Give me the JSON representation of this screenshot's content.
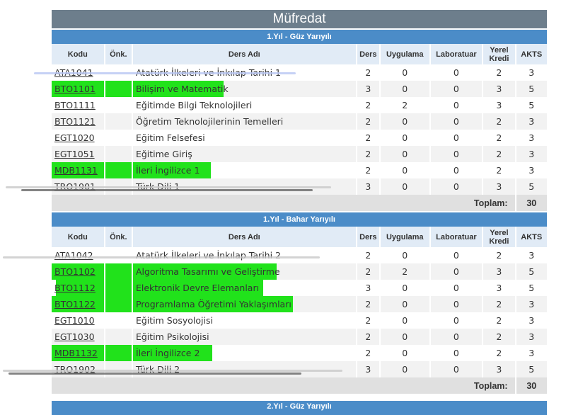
{
  "page_title": "Müfredat",
  "columns": [
    "Kodu",
    "Önk.",
    "Ders Adı",
    "Ders",
    "Uygulama",
    "Laboratuar",
    "Yerel Kredi",
    "AKTS"
  ],
  "total_label": "Toplam:",
  "semesters": [
    {
      "title": "1.Yıl - Güz Yarıyılı",
      "total": "30",
      "courses": [
        {
          "code": "ATA1041",
          "name": "Atatürk İlkeleri ve İnkılap Tarihi 1",
          "ders": "2",
          "uyg": "0",
          "lab": "0",
          "kredi": "2",
          "akts": "3"
        },
        {
          "code": "BTO1101",
          "name": "Bilişim ve Matematik",
          "ders": "3",
          "uyg": "0",
          "lab": "0",
          "kredi": "3",
          "akts": "5"
        },
        {
          "code": "BTO1111",
          "name": "Eğitimde Bilgi Teknolojileri",
          "ders": "2",
          "uyg": "2",
          "lab": "0",
          "kredi": "3",
          "akts": "5"
        },
        {
          "code": "BTO1121",
          "name": "Öğretim Teknolojilerinin Temelleri",
          "ders": "2",
          "uyg": "0",
          "lab": "0",
          "kredi": "2",
          "akts": "3"
        },
        {
          "code": "EGT1020",
          "name": "Eğitim Felsefesi",
          "ders": "2",
          "uyg": "0",
          "lab": "0",
          "kredi": "2",
          "akts": "3"
        },
        {
          "code": "EGT1051",
          "name": "Eğitime Giriş",
          "ders": "2",
          "uyg": "0",
          "lab": "0",
          "kredi": "2",
          "akts": "3"
        },
        {
          "code": "MDB1131",
          "name": "İleri İngilizce 1",
          "ders": "2",
          "uyg": "0",
          "lab": "0",
          "kredi": "2",
          "akts": "3"
        },
        {
          "code": "TRO1901",
          "name": "Türk Dili 1",
          "ders": "3",
          "uyg": "0",
          "lab": "0",
          "kredi": "3",
          "akts": "5"
        }
      ]
    },
    {
      "title": "1.Yıl - Bahar Yarıyılı",
      "total": "30",
      "courses": [
        {
          "code": "ATA1042",
          "name": "Atatürk İlkeleri ve İnkılap Tarihi 2",
          "ders": "2",
          "uyg": "0",
          "lab": "0",
          "kredi": "2",
          "akts": "3"
        },
        {
          "code": "BTO1102",
          "name": "Algoritma Tasarımı ve Geliştirme",
          "ders": "2",
          "uyg": "2",
          "lab": "0",
          "kredi": "3",
          "akts": "5"
        },
        {
          "code": "BTO1112",
          "name": "Elektronik Devre Elemanları",
          "ders": "3",
          "uyg": "0",
          "lab": "0",
          "kredi": "3",
          "akts": "5"
        },
        {
          "code": "BTO1122",
          "name": "Programlama Öğretimi Yaklaşımları",
          "ders": "2",
          "uyg": "0",
          "lab": "0",
          "kredi": "2",
          "akts": "3"
        },
        {
          "code": "EGT1010",
          "name": "Eğitim Sosyolojisi",
          "ders": "2",
          "uyg": "0",
          "lab": "0",
          "kredi": "2",
          "akts": "3"
        },
        {
          "code": "EGT1030",
          "name": "Eğitim Psikolojisi",
          "ders": "2",
          "uyg": "0",
          "lab": "0",
          "kredi": "2",
          "akts": "3"
        },
        {
          "code": "MDB1132",
          "name": "İleri İngilizce 2",
          "ders": "2",
          "uyg": "0",
          "lab": "0",
          "kredi": "2",
          "akts": "3"
        },
        {
          "code": "TRO1902",
          "name": "Türk Dili 2",
          "ders": "3",
          "uyg": "0",
          "lab": "0",
          "kredi": "3",
          "akts": "5"
        }
      ]
    }
  ],
  "next_semester_title": "2.Yıl - Güz Yarıyılı",
  "colors": {
    "highlight": "#21e21b",
    "header_blue": "#4b8cc8",
    "title_gray": "#6d7e8c"
  }
}
